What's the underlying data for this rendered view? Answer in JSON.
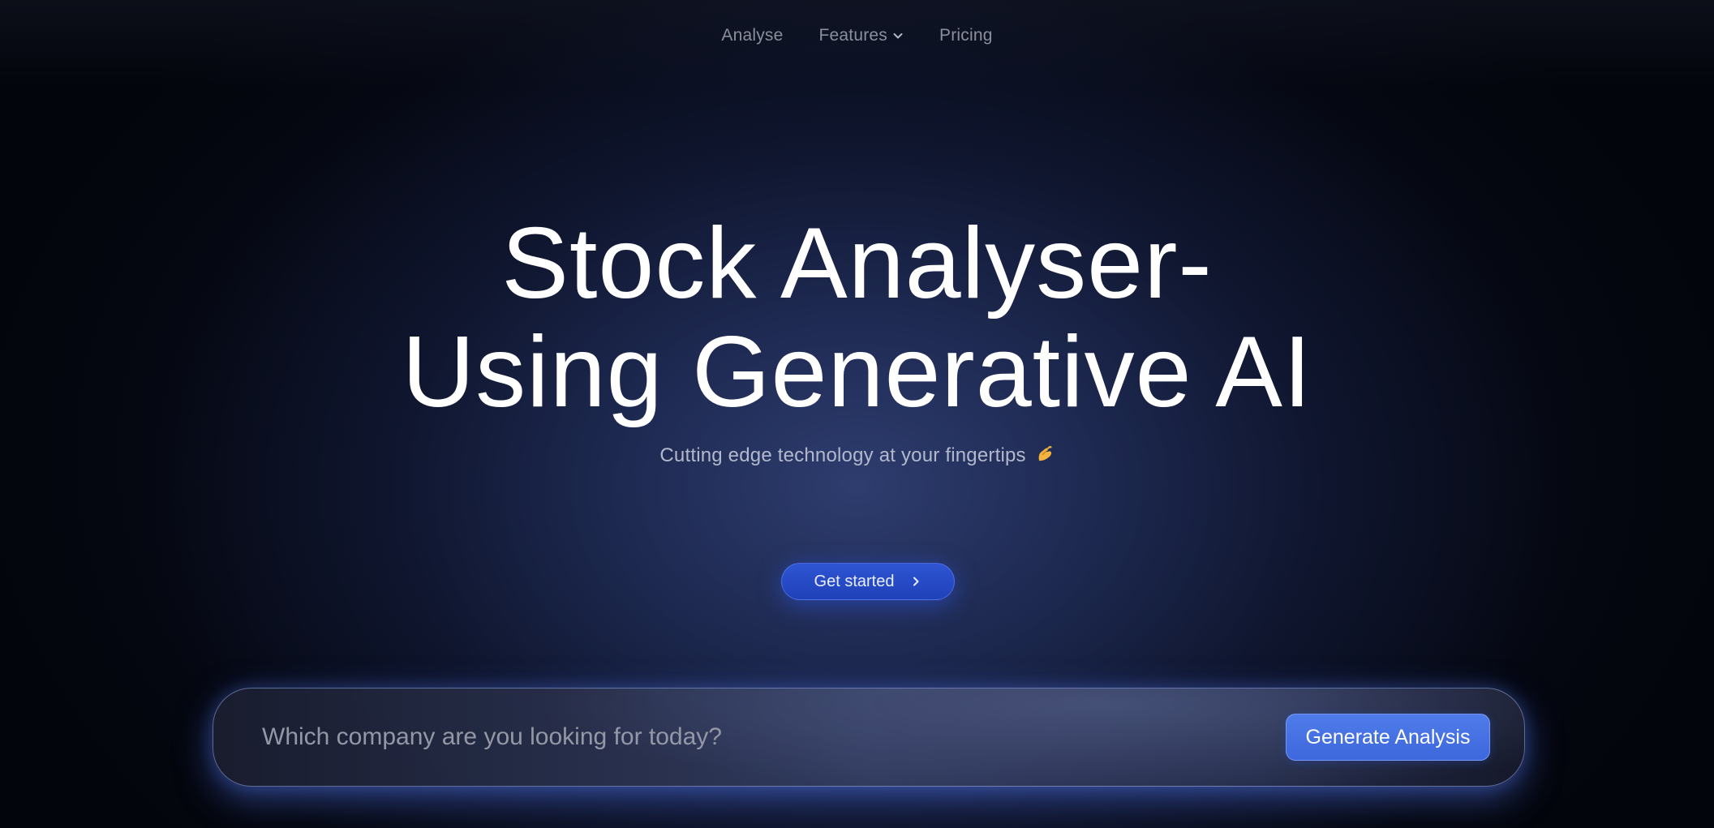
{
  "nav": {
    "items": [
      {
        "label": "Analyse"
      },
      {
        "label": "Features",
        "icon": "chevron-down-icon"
      },
      {
        "label": "Pricing"
      }
    ]
  },
  "hero": {
    "title_line1": "Stock Analyser-",
    "title_line2": "Using Generative AI",
    "subtitle": "Cutting edge technology at your fingertips",
    "subtitle_icon": "pinching-hand-emoji-icon"
  },
  "cta": {
    "label": "Get started",
    "icon": "chevron-right-icon"
  },
  "search": {
    "placeholder": "Which company are you looking for today?",
    "value": "",
    "button_label": "Generate Analysis"
  },
  "colors": {
    "background": "#03050c",
    "accent": "#2f55d4",
    "generate_button": "#4f7cea",
    "nav_text": "#8b8f9c",
    "subtitle_text": "#b3b9cc"
  }
}
